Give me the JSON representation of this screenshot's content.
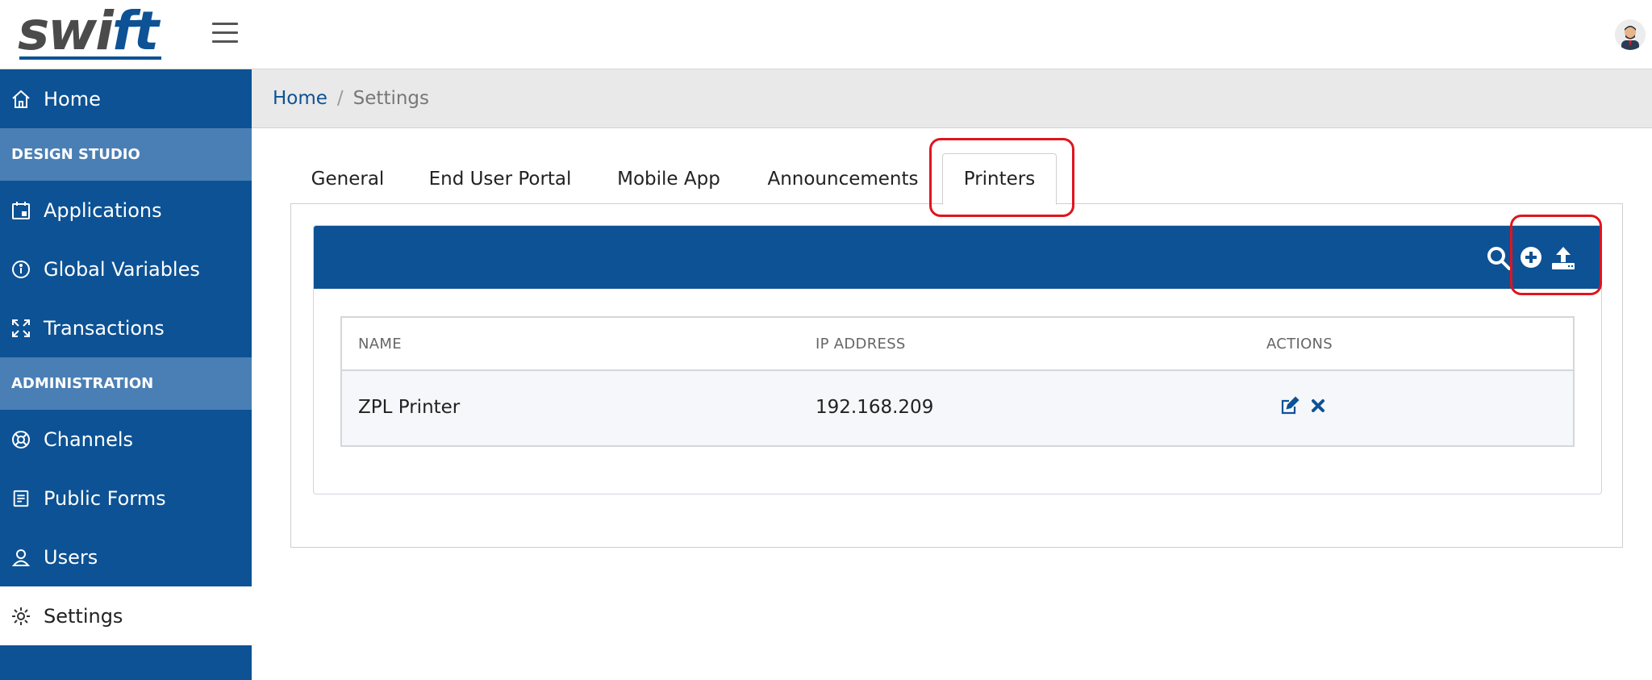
{
  "brand": {
    "logo_prefix": "swi",
    "logo_suffix": "ft"
  },
  "sidebar": {
    "items": [
      {
        "label": "Home",
        "icon": "home-icon"
      },
      {
        "label": "Applications",
        "icon": "calendar-icon"
      },
      {
        "label": "Global Variables",
        "icon": "info-icon"
      },
      {
        "label": "Transactions",
        "icon": "expand-arrows-icon"
      },
      {
        "label": "Channels",
        "icon": "lifebuoy-icon"
      },
      {
        "label": "Public Forms",
        "icon": "form-icon"
      },
      {
        "label": "Users",
        "icon": "user-icon"
      },
      {
        "label": "Settings",
        "icon": "gear-icon"
      }
    ],
    "sections": [
      "DESIGN STUDIO",
      "ADMINISTRATION"
    ],
    "active": "Settings"
  },
  "breadcrumb": {
    "home": "Home",
    "separator": "/",
    "current": "Settings"
  },
  "tabs": [
    {
      "label": "General"
    },
    {
      "label": "End User Portal"
    },
    {
      "label": "Mobile App"
    },
    {
      "label": "Announcements"
    },
    {
      "label": "Printers"
    }
  ],
  "active_tab": "Printers",
  "toolbar": {
    "icons": [
      "search-icon",
      "add-circle-icon",
      "upload-icon"
    ]
  },
  "table": {
    "columns": [
      "NAME",
      "IP ADDRESS",
      "ACTIONS"
    ],
    "rows": [
      {
        "name": "ZPL Printer",
        "ip": "192.168.209",
        "actions": [
          "edit-icon",
          "delete-icon"
        ]
      }
    ]
  },
  "colors": {
    "primary": "#0d5294",
    "section": "#4a7fb5",
    "highlight": "#e0141e"
  }
}
